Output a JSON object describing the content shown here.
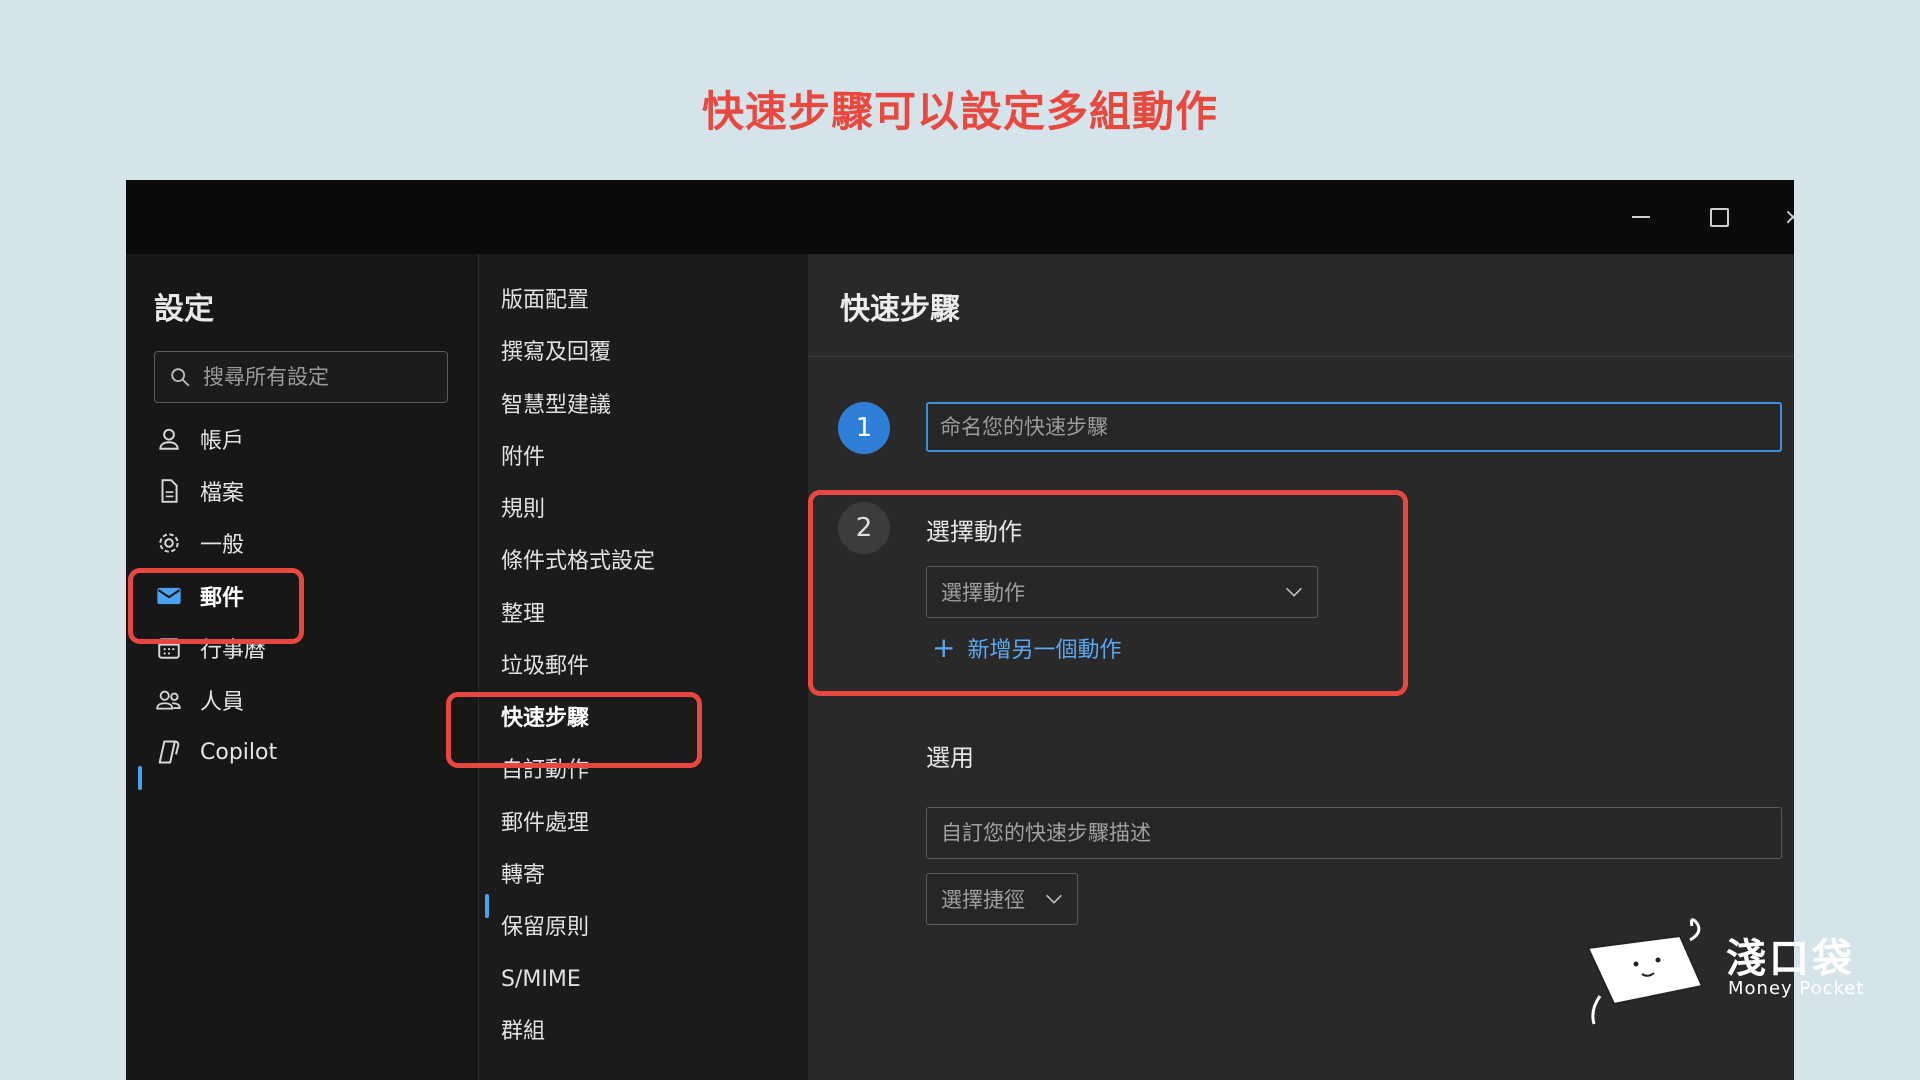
{
  "heading": "快速步驟可以設定多組動作",
  "window": {
    "minimize_icon": "minimize-icon",
    "maximize_icon": "maximize-icon",
    "close_glyph": "×"
  },
  "settings_nav": {
    "title": "設定",
    "search_placeholder": "搜尋所有設定",
    "items": [
      {
        "label": "帳戶",
        "icon": "person-icon"
      },
      {
        "label": "檔案",
        "icon": "document-icon"
      },
      {
        "label": "一般",
        "icon": "gear-icon"
      },
      {
        "label": "郵件",
        "icon": "mail-icon",
        "active": true
      },
      {
        "label": "行事曆",
        "icon": "calendar-icon"
      },
      {
        "label": "人員",
        "icon": "people-icon"
      },
      {
        "label": "Copilot",
        "icon": "copilot-icon"
      }
    ]
  },
  "mail_nav": {
    "items": [
      {
        "label": "版面配置"
      },
      {
        "label": "撰寫及回覆"
      },
      {
        "label": "智慧型建議"
      },
      {
        "label": "附件"
      },
      {
        "label": "規則"
      },
      {
        "label": "條件式格式設定"
      },
      {
        "label": "整理"
      },
      {
        "label": "垃圾郵件"
      },
      {
        "label": "快速步驟",
        "active": true
      },
      {
        "label": "自訂動作"
      },
      {
        "label": "郵件處理"
      },
      {
        "label": "轉寄"
      },
      {
        "label": "保留原則"
      },
      {
        "label": "S/MIME"
      },
      {
        "label": "群組"
      }
    ]
  },
  "quick_steps": {
    "title": "快速步驟",
    "step1_number": "1",
    "name_placeholder": "命名您的快速步驟",
    "step2_number": "2",
    "choose_action_label": "選擇動作",
    "action_select_value": "選擇動作",
    "add_action_label": "新增另一個動作",
    "optional_label": "選用",
    "description_placeholder": "自訂您的快速步驟描述",
    "shortcut_select_value": "選擇捷徑"
  },
  "watermark": {
    "title": "淺口袋",
    "subtitle": "Money Pocket"
  },
  "colors": {
    "highlight": "#e8473f",
    "accent": "#2f7fd8",
    "link": "#5aa8f2"
  }
}
